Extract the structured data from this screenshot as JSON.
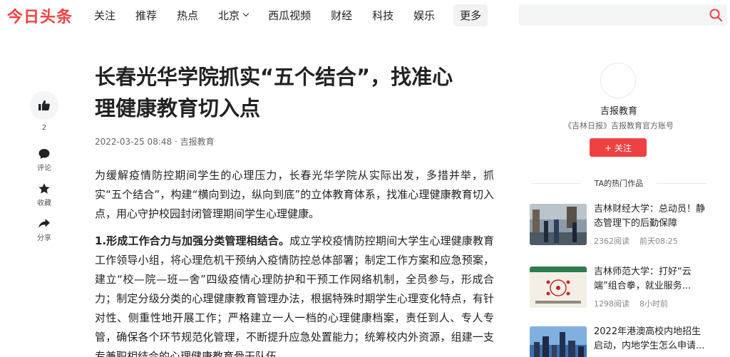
{
  "logo": "今日头条",
  "nav": {
    "items": [
      "关注",
      "推荐",
      "热点",
      "北京",
      "西瓜视频",
      "财经",
      "科技",
      "娱乐"
    ],
    "more": "更多"
  },
  "search": {
    "placeholder": ""
  },
  "rail": {
    "like_count": "2",
    "comment": "评论",
    "collect": "收藏",
    "share": "分享"
  },
  "article": {
    "title_line1": "长春光华学院抓实“五个结合”，找准心",
    "title_line2": "理健康教育切入点",
    "meta": "2022-03-25 08:48 · 吉报教育",
    "para1": "为缓解疫情防控期间学生的心理压力，长春光华学院从实际出发，多措并举，抓实“五个结合”，构建“横向到边，纵向到底”的立体教育体系，找准心理健康教育切入点，用心守护校园封闭管理期间学生心理健康。",
    "para2_bold": "1.形成工作合力与加强分类管理相结合。",
    "para2_text": "成立学校疫情防控期间大学生心理健康教育工作领导小组，将心理危机干预纳入疫情防控总体部署；制定工作方案和应急预案，建立“校—院—班—舍”四级疫情心理防护和干预工作网络机制，全员参与，形成合力；制定分级分类的心理健康教育管理办法，根据特殊时期学生心理变化特点，有针对性、侧重性地开展工作；严格建立一人一档的心理健康档案，责任到人、专人专管，确保各个环节规范化管理，不断提升应急处置能力；统筹校内外资源，组建一支专兼职相结合的心理健康教育骨干队伍。"
  },
  "sidebar": {
    "author": "吉报教育",
    "author_desc": "《吉林日报》吉报教育官方账号",
    "follow": "+ 关注",
    "hot_heading": "TA的热门作品",
    "hot": [
      {
        "title": "吉林财经大学：总动员！静态管理下的后勤保障",
        "reads": "2362阅读",
        "time": "前天08:25"
      },
      {
        "title": "吉林师范大学：打好“云端”组合拳，就业服务...",
        "reads": "1298阅读",
        "time": "8小时前"
      },
      {
        "title": "2022年港澳高校内地招生启动，内地学生怎么申请...",
        "reads": "",
        "time": ""
      }
    ]
  },
  "colors": {
    "brand": "#f04142"
  }
}
